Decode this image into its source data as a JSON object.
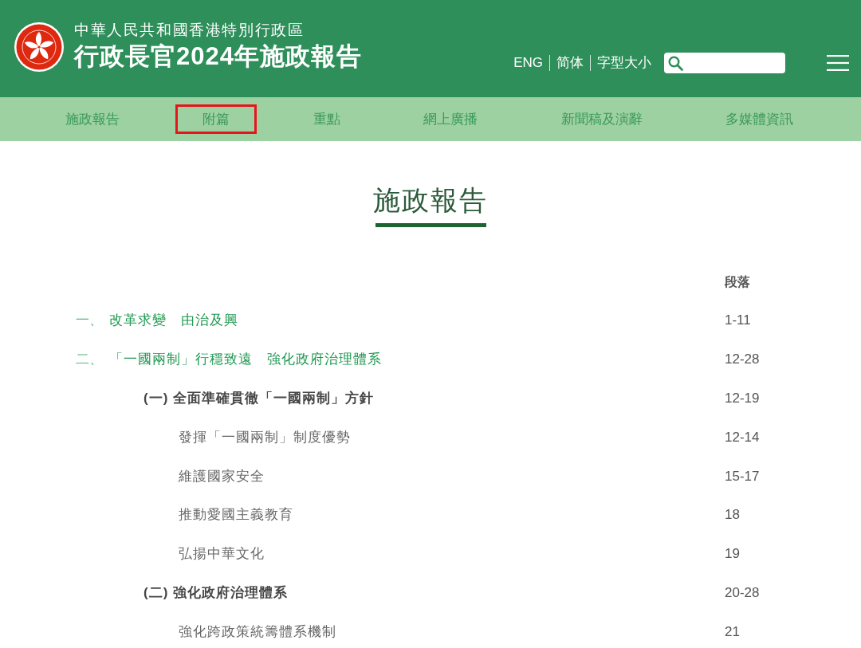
{
  "header": {
    "subtitle": "中華人民共和國香港特別行政區",
    "title": "行政長官2024年施政報告",
    "language_links": [
      "ENG",
      "简体",
      "字型大小"
    ]
  },
  "nav": [
    {
      "label": "施政報告",
      "highlighted": false
    },
    {
      "label": "附篇",
      "highlighted": true
    },
    {
      "label": "重點",
      "highlighted": false
    },
    {
      "label": "網上廣播",
      "highlighted": false
    },
    {
      "label": "新聞稿及演辭",
      "highlighted": false
    },
    {
      "label": "多媒體資訊",
      "highlighted": false
    }
  ],
  "page_title": "施政報告",
  "contents": {
    "column_header": "段落",
    "sections": [
      {
        "number": "一、",
        "title": "改革求變　由治及興",
        "paragraphs": "1-11"
      },
      {
        "number": "二、",
        "title": "「一國兩制」行穩致遠　強化政府治理體系",
        "paragraphs": "12-28",
        "children": [
          {
            "title": "(一) 全面準確貫徹「一國兩制」方針",
            "paragraphs": "12-19",
            "children": [
              {
                "title": "發揮「一國兩制」制度優勢",
                "paragraphs": "12-14"
              },
              {
                "title": "維護國家安全",
                "paragraphs": "15-17"
              },
              {
                "title": "推動愛國主義教育",
                "paragraphs": "18"
              },
              {
                "title": "弘揚中華文化",
                "paragraphs": "19"
              }
            ]
          },
          {
            "title": "(二) 強化政府治理體系",
            "paragraphs": "20-28",
            "children": [
              {
                "title": "強化跨政策統籌體系機制",
                "paragraphs": "21"
              }
            ]
          }
        ]
      }
    ]
  }
}
